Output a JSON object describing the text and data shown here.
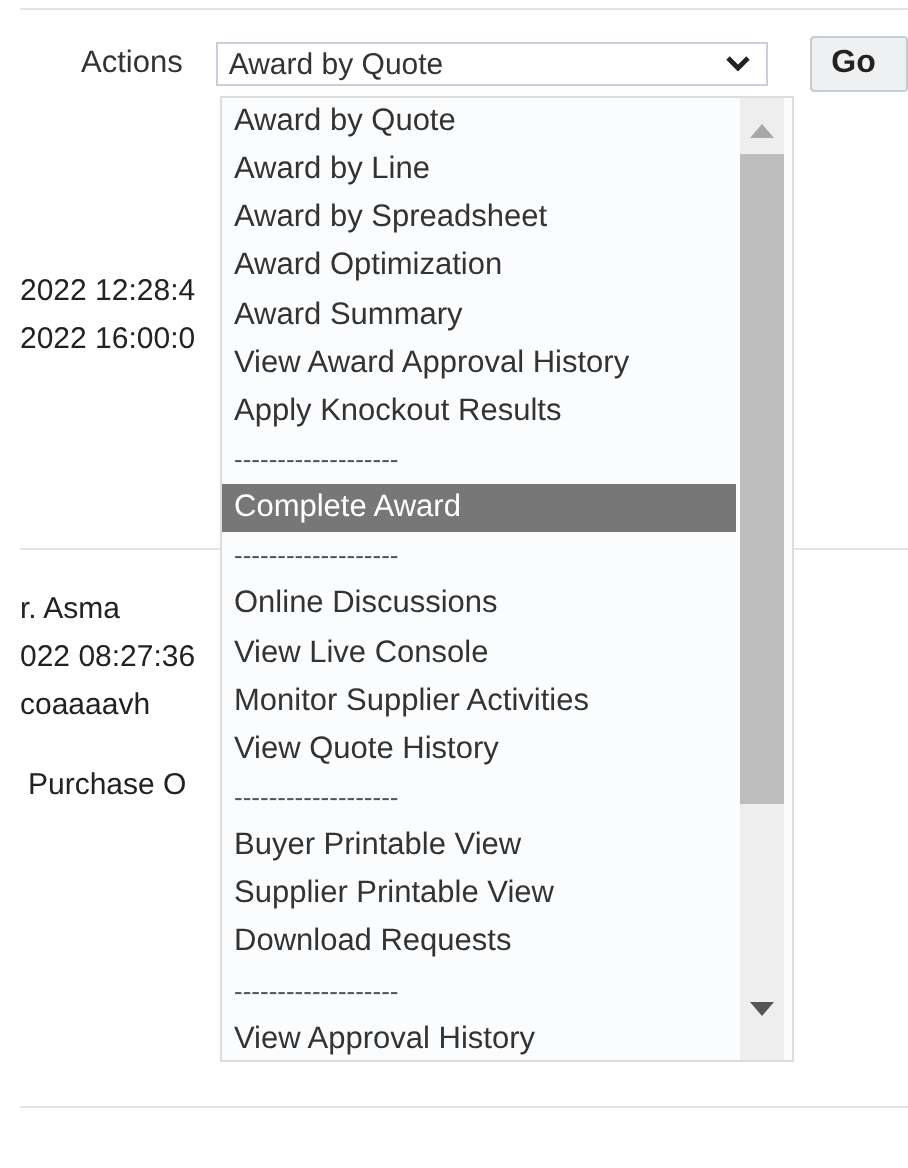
{
  "actions": {
    "label": "Actions",
    "select_value": "Award by Quote",
    "go_button": "Go"
  },
  "dropdown_items": [
    {
      "label": "Award by Quote",
      "kind": "option",
      "selected": false
    },
    {
      "label": "Award by Line",
      "kind": "option",
      "selected": false
    },
    {
      "label": "Award by Spreadsheet",
      "kind": "option",
      "selected": false
    },
    {
      "label": "Award Optimization",
      "kind": "option",
      "selected": false
    },
    {
      "label": "Award Summary",
      "kind": "option",
      "selected": false
    },
    {
      "label": "View Award Approval History",
      "kind": "option",
      "selected": false
    },
    {
      "label": "Apply Knockout Results",
      "kind": "option",
      "selected": false
    },
    {
      "label": "-------------------",
      "kind": "separator",
      "selected": false
    },
    {
      "label": "Complete Award",
      "kind": "option",
      "selected": true
    },
    {
      "label": "-------------------",
      "kind": "separator",
      "selected": false
    },
    {
      "label": "Online Discussions",
      "kind": "option",
      "selected": false
    },
    {
      "label": "View Live Console",
      "kind": "option",
      "selected": false
    },
    {
      "label": "Monitor Supplier Activities",
      "kind": "option",
      "selected": false
    },
    {
      "label": "View Quote History",
      "kind": "option",
      "selected": false
    },
    {
      "label": "-------------------",
      "kind": "separator",
      "selected": false
    },
    {
      "label": "Buyer Printable View",
      "kind": "option",
      "selected": false
    },
    {
      "label": "Supplier Printable View",
      "kind": "option",
      "selected": false
    },
    {
      "label": "Download Requests",
      "kind": "option",
      "selected": false
    },
    {
      "label": "-------------------",
      "kind": "separator",
      "selected": false
    },
    {
      "label": "View Approval History",
      "kind": "option",
      "selected": false
    }
  ],
  "section_1": [
    "2022 12:28:4",
    "2022 16:00:0"
  ],
  "section_2": [
    "r. Asma",
    "022 08:27:36",
    "coaaaavh",
    "Purchase O"
  ]
}
